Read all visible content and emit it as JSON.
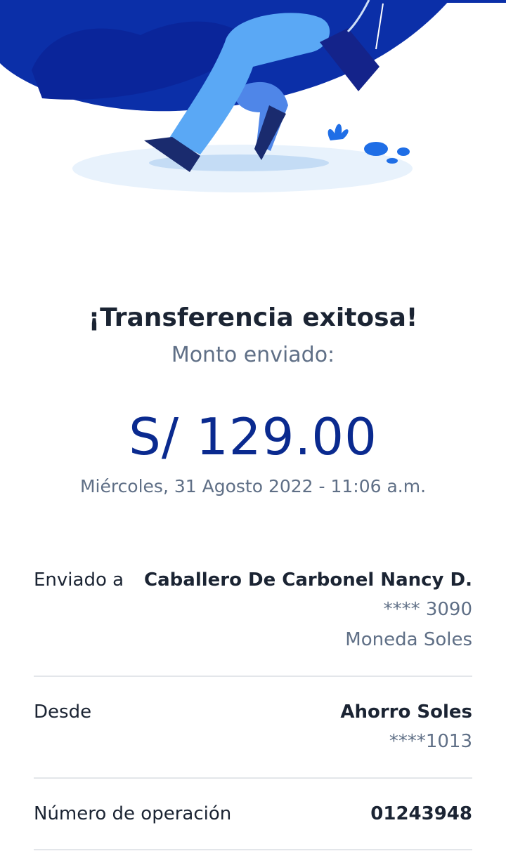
{
  "result": {
    "title": "¡Transferencia exitosa!",
    "amount_label": "Monto enviado:",
    "amount": "S/ 129.00",
    "datetime": "Miércoles, 31 Agosto 2022 - 11:06 a.m."
  },
  "details": {
    "recipient": {
      "label": "Enviado a",
      "name": "Caballero De Carbonel Nancy D.",
      "account": "**** 3090",
      "currency": "Moneda Soles"
    },
    "source": {
      "label": "Desde",
      "account_name": "Ahorro Soles",
      "account_number": "****1013"
    },
    "operation": {
      "label": "Número de operación",
      "number": "01243948"
    }
  },
  "colors": {
    "accent": "#0a2a8f",
    "hero_blue": "#0b2fa8",
    "illustration_light": "#5aa8f5",
    "text_primary": "#1b2433",
    "text_secondary": "#5f6f86"
  }
}
